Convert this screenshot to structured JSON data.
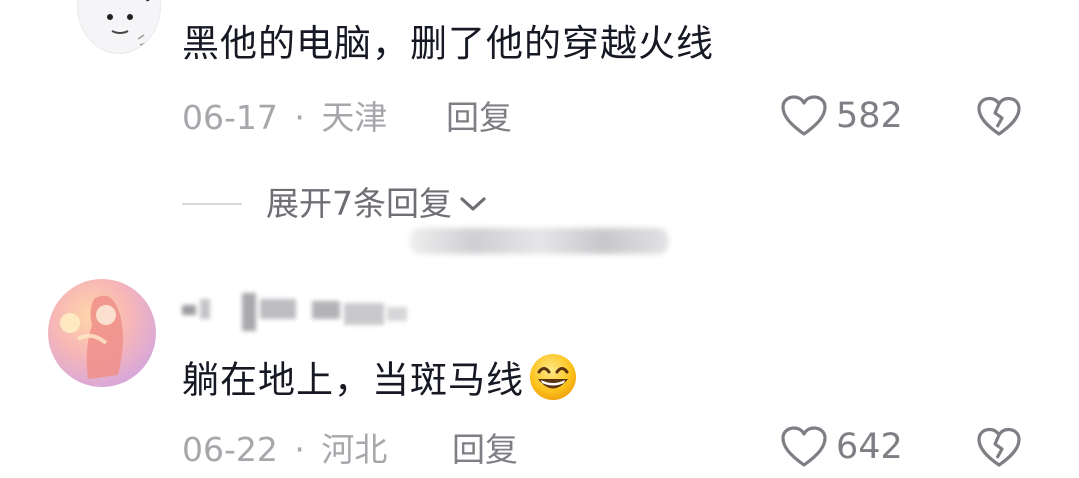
{
  "comments": [
    {
      "text": "黑他的电脑，删了他的穿越火线",
      "date": "06-17",
      "separator": "·",
      "location": "天津",
      "reply_label": "回复",
      "like_count": "582"
    },
    {
      "text": "躺在地上，当斑马线",
      "emoji": "grinning-face-emoji",
      "date": "06-22",
      "separator": "·",
      "location": "河北",
      "reply_label": "回复",
      "like_count": "642"
    }
  ],
  "expand_replies": {
    "label": "展开7条回复"
  },
  "icons": {
    "like": "heart-outline-icon",
    "dislike": "broken-heart-icon",
    "expand": "chevron-down-icon"
  },
  "colors": {
    "text_primary": "#161823",
    "text_meta": "#a6a7ab",
    "text_secondary": "#7e7f84"
  }
}
